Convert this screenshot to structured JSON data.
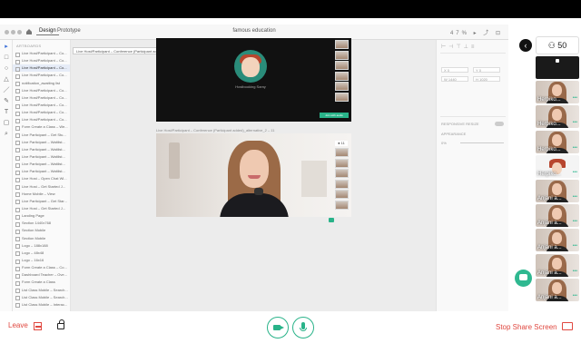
{
  "app": {
    "tabs": [
      "Design",
      "Prototype"
    ],
    "title": "famous education",
    "zoom": "47%"
  },
  "layers": {
    "header": "ARTBOARDS",
    "items": [
      "Live Host/Participant – Co...",
      "Live Host/Participant – Co...",
      "Live Host/Participant – Co...",
      "Live Host/Participant – Co...",
      "notification_awaiting list",
      "Live Host/Participant – Co...",
      "Live Host/Participant – Co...",
      "Live Host/Participant – Co...",
      "Live Host/Participant – Co...",
      "Live Host/Participant – Co...",
      "Form Create a Class – We...",
      "Live Participant – Get Stu...",
      "Live Participant – Waitlist...",
      "Live Participant – Waitlist...",
      "Live Participant – Waitlist...",
      "Live Participant – Waitlist...",
      "Live Participant – Waitlist...",
      "Live Host – Open Chat Wi...",
      "Live Host – Get Started J...",
      "Home Mobile – View",
      "Live Participant – Get Star...",
      "Live Host – Get Started J...",
      "Landing Page",
      "Section 1440x768",
      "Section Mobile",
      "Section Mobile",
      "Logo – 188x188",
      "Logo – 48x48",
      "Logo – 16x16",
      "Form Create a Class – Co...",
      "Dashboard Teacher – Ove...",
      "Form Create a Class",
      "List Class Mobile – Search...",
      "List Class Mobile – Search...",
      "List Class Mobile – Interac..."
    ],
    "selected_index": 2,
    "tooltip": "Live Host/Participant – Conference (Participant added)_alternative_2 – 6"
  },
  "canvas": {
    "frame1_avatar_name": "Hostbooking Samy",
    "frame1_badge": "Join with audio",
    "frame2_label": "Live Host/Participant – Conference (Participant added)_alternative_2 – 11",
    "frame2_badge": "● 11"
  },
  "inspector": {
    "x_label": "X  0",
    "y_label": "Y  0",
    "w_label": "W  1440",
    "h_label": "H  1020",
    "responsive_resize": "RESPONSIVE RESIZE",
    "appearance": "APPEARANCE",
    "opacity": "0%"
  },
  "meeting": {
    "participant_count": "50",
    "participants": [
      {
        "name": "",
        "kind": "dark"
      },
      {
        "name": "Herpiko...",
        "kind": "person"
      },
      {
        "name": "Herpiko...",
        "kind": "person"
      },
      {
        "name": "Herpiko...",
        "kind": "person"
      },
      {
        "name": "Herpiko...",
        "kind": "avatar"
      },
      {
        "name": "Anjani a...",
        "kind": "person"
      },
      {
        "name": "Anjani a...",
        "kind": "person"
      },
      {
        "name": "Anjani a...",
        "kind": "person"
      },
      {
        "name": "Anjani a...",
        "kind": "person"
      },
      {
        "name": "Anjani a...",
        "kind": "person"
      }
    ],
    "leave_label": "Leave",
    "stop_share_label": "Stop Share Screen",
    "accent": "#29b389",
    "danger": "#e0473f"
  }
}
